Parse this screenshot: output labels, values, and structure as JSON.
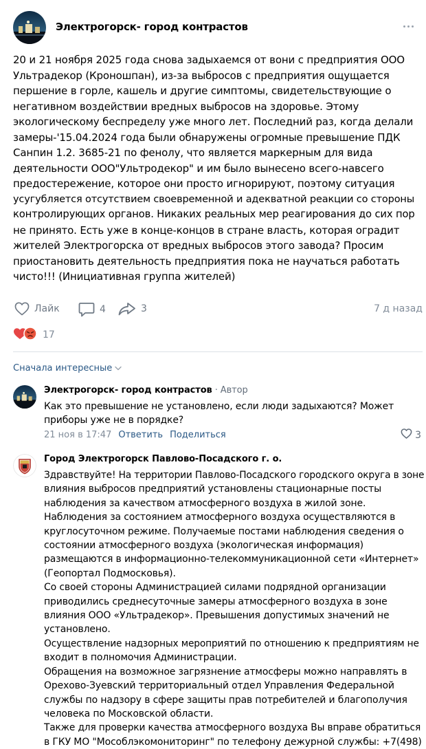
{
  "post": {
    "author": "Электрогорск- город контрастов",
    "text_lines": [
      "20 и 21 ноября 2025 года снова задыхаемся от вони с предприятия ООО",
      "Ультрадекор (Кроношпан), из-за выбросов с предприятия ощущается",
      "першение в горле, кашель и другие симптомы, свидетельствующие о",
      "негативном воздействии вредных выбросов на здоровье. Этому",
      "экологическому беспределу уже много лет. Последний раз, когда делали",
      "замеры-'15.04.2024 года были обнаружены огромные превышение ПДК",
      "Санпин 1.2. 3685-21 по фенолу, что является маркерным для вида",
      "деятельности ООО\"Ультродекор\" и им было вынесено всего-навсего",
      "предостережение, которое они просто игнорируют, поэтому ситуация",
      "усугубляется отсутствием своевременной и адекватной реакции со стороны",
      "контролирующих органов. Никаких реальных мер реагирования до сих пор",
      "не принято. Есть уже в конце-концов в стране власть, которая оградит",
      "жителей Электрогорска от вредных выбросов этого завода? Просим",
      "приостановить деятельность предприятия пока не научаться работать",
      "чисто!!! (Инициативная группа жителей)"
    ],
    "like_label": "Лайк",
    "comments_count": "4",
    "shares_count": "3",
    "time": "7 д назад",
    "reactions_count": "17"
  },
  "sort_label": "Сначала интересные",
  "comments": [
    {
      "author": "Электрогорск- город контрастов",
      "role": " · Автор",
      "text_lines": [
        "Как это превышение не установлено, если люди задыхаются? Может",
        "приборы уже не в порядке?"
      ],
      "date": "21 ноя в 17:47",
      "reply_label": "Ответить",
      "share_label": "Поделиться",
      "likes": "3"
    },
    {
      "author": "Город Электрогорск Павлово-Посадского г. о.",
      "text_lines": [
        "Здравствуйте! На территории Павлово-Посадского городского округа в зоне",
        "влияния выбросов предприятий установлены стационарные посты",
        "наблюдения за качеством атмосферного воздуха в жилой зоне.",
        "Наблюдения за состоянием атмосферного воздуха осуществляются в",
        "круглосуточном режиме. Получаемые постами наблюдения сведения о",
        "состоянии атмосферного воздуха (экологическая информация)",
        "размещаются в информационно-телекоммуникационной сети «Интернет»",
        "(Геопортал Подмосковья).",
        "Со своей стороны Администрацией силами подрядной организации",
        "приводились среднесуточные замеры атмосферного воздуха в зоне",
        "влияния ООО «Ультрадекор». Превышения допустимых значений не",
        "установлено.",
        "Осуществление надзорных мероприятий по отношению к предприятиям не",
        "входит в полномочия Администрации.",
        "Обращения на возможное загрязнение атмосферы можно направлять в",
        "Орехово-Зуевский территориальный отдел Управления Федеральной",
        "службы по надзору в сфере защиты прав потребителей и благополучия",
        "человека по Московской области.",
        "Также для проверки качества атмосферного воздуха Вы вправе обратиться",
        "в ГКУ МО \"Мособлэкомониторинг\" по телефону дежурной службы: +7(498)"
      ]
    }
  ],
  "colors": {
    "link": "#2a5885",
    "secondary_text": "#818c99",
    "icon": "#6f7985",
    "divider": "#dce1e6"
  },
  "icons": {
    "more": "more-dots-icon",
    "like": "heart-outline-icon",
    "comment": "comment-bubble-icon",
    "share": "share-arrow-icon",
    "reactions": [
      "heart-reaction-icon",
      "angry-reaction-icon"
    ],
    "sort_chevron": "chevron-down-icon"
  }
}
